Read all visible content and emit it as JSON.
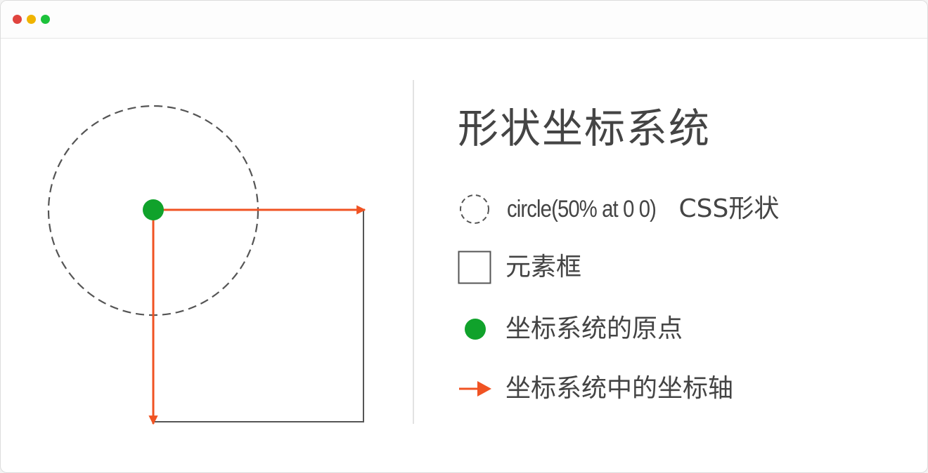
{
  "window": {
    "controls": [
      {
        "name": "close",
        "color": "#e0443e"
      },
      {
        "name": "minimize",
        "color": "#f0b400"
      },
      {
        "name": "maximize",
        "color": "#1cc23b"
      }
    ]
  },
  "colors": {
    "axis": "#f05323",
    "origin": "#10a22b",
    "outline": "#555555",
    "text": "#444444"
  },
  "legend": {
    "title": "形状坐标系统",
    "items": [
      {
        "icon": "dashed-circle-icon",
        "code": "circle(50% at 0 0)",
        "label": "CSS形状"
      },
      {
        "icon": "square-outline-icon",
        "label": "元素框"
      },
      {
        "icon": "green-dot-icon",
        "label": "坐标系统的原点"
      },
      {
        "icon": "red-arrow-icon",
        "label": "坐标系统中的坐标轴"
      }
    ]
  }
}
